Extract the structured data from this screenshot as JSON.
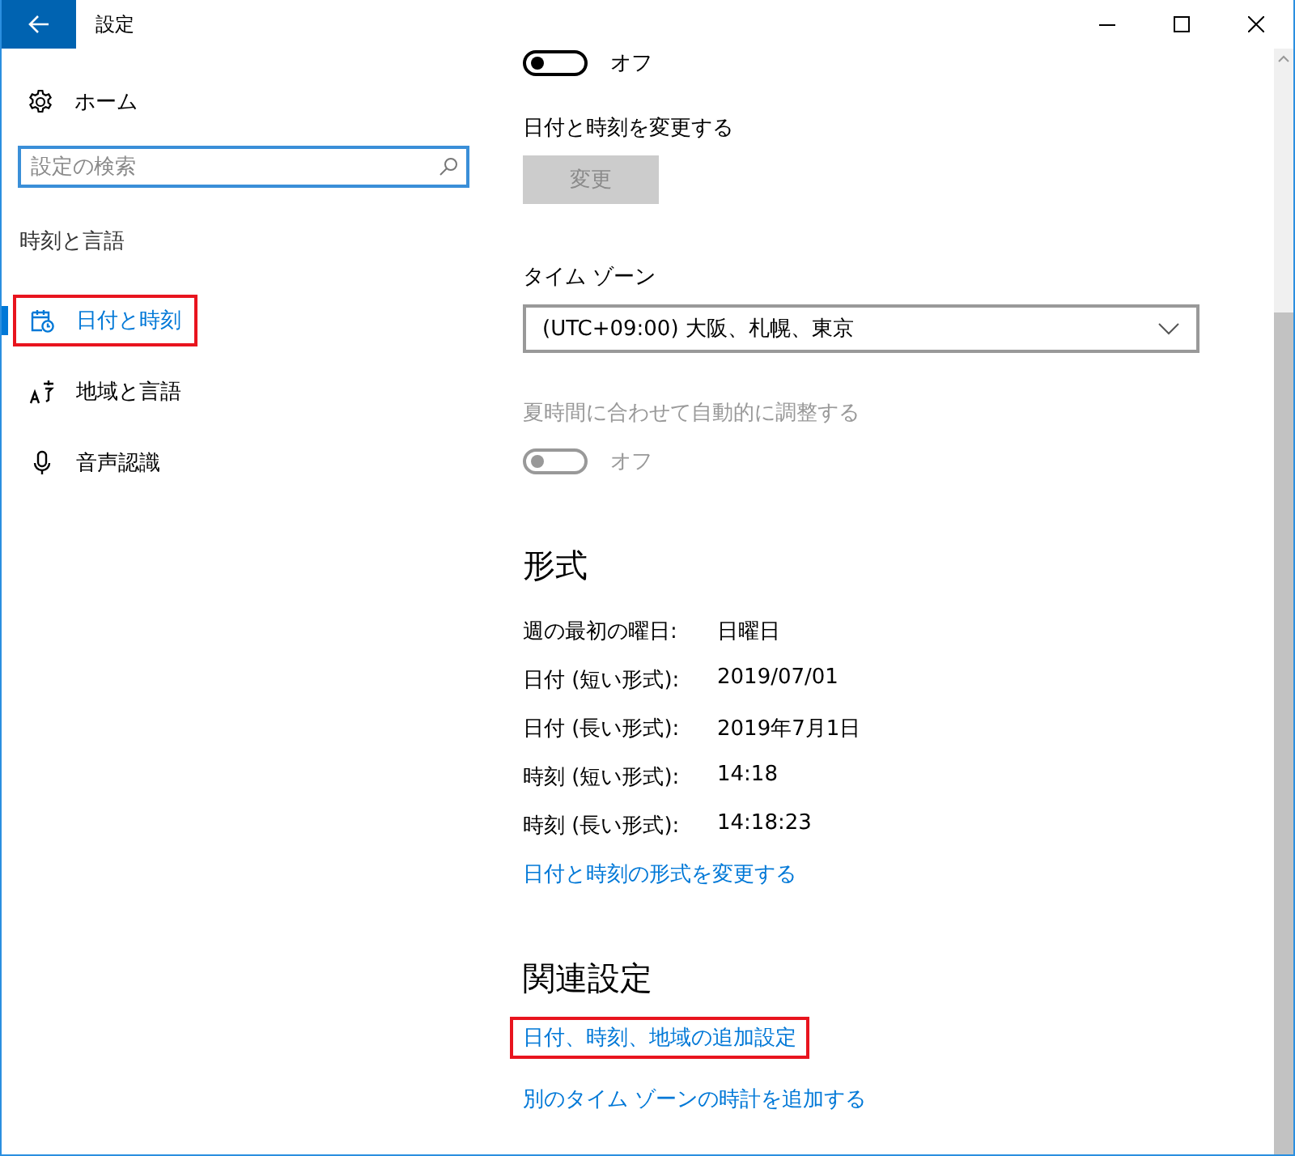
{
  "window": {
    "title": "設定"
  },
  "sidebar": {
    "home": "ホーム",
    "search": {
      "placeholder": "設定の検索"
    },
    "section": "時刻と言語",
    "items": [
      {
        "label": "日付と時刻",
        "kind": "calendar",
        "selected": true,
        "highlighted": true
      },
      {
        "label": "地域と言語",
        "kind": "language",
        "selected": false,
        "highlighted": false
      },
      {
        "label": "音声認識",
        "kind": "microphone",
        "selected": false,
        "highlighted": false
      }
    ]
  },
  "content": {
    "auto_toggle": {
      "on": false,
      "disabled": false,
      "label": "オフ"
    },
    "change_heading": "日付と時刻を変更する",
    "change_button": {
      "label": "変更",
      "disabled": true
    },
    "timezone_label": "タイム ゾーン",
    "timezone": {
      "value": "(UTC+09:00) 大阪、札幌、東京"
    },
    "dst_label": "夏時間に合わせて自動的に調整する",
    "dst_toggle": {
      "on": false,
      "disabled": true,
      "label": "オフ"
    },
    "format_heading": "形式",
    "format_rows": [
      {
        "label": "週の最初の曜日:",
        "value": "日曜日"
      },
      {
        "label": "日付 (短い形式):",
        "value": "2019/07/01"
      },
      {
        "label": "日付 (長い形式):",
        "value": "2019年7月1日"
      },
      {
        "label": "時刻 (短い形式):",
        "value": "14:18"
      },
      {
        "label": "時刻 (長い形式):",
        "value": "14:18:23"
      }
    ],
    "format_link": {
      "label": "日付と時刻の形式を変更する",
      "highlighted": false
    },
    "related_heading": "関連設定",
    "related_links": [
      {
        "label": "日付、時刻、地域の追加設定",
        "highlighted": true
      },
      {
        "label": "別のタイム ゾーンの時計を追加する",
        "highlighted": false
      }
    ]
  }
}
